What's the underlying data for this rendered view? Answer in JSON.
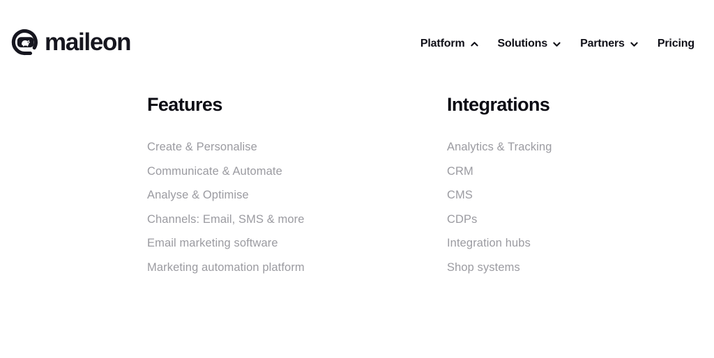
{
  "brand": {
    "name": "maileon",
    "logo_icon": "maileon-circle-mark-icon",
    "color": "#16161f"
  },
  "header": {
    "nav_items": [
      {
        "label": "Platform",
        "icon": "chevron-up-icon",
        "expanded": true
      },
      {
        "label": "Solutions",
        "icon": "chevron-down-icon",
        "expanded": false
      },
      {
        "label": "Partners",
        "icon": "chevron-down-icon",
        "expanded": false
      },
      {
        "label": "Pricing",
        "icon": "",
        "expanded": false
      }
    ]
  },
  "mega_menu": {
    "open_for": "Platform",
    "columns": [
      {
        "title": "Features",
        "links": [
          "Create & Personalise",
          "Communicate & Automate",
          "Analyse & Optimise",
          "Channels: Email, SMS & more",
          "Email marketing software",
          "Marketing automation platform"
        ]
      },
      {
        "title": "Integrations",
        "links": [
          "Analytics & Tracking",
          "CRM",
          "CMS",
          "CDPs",
          "Integration hubs",
          "Shop systems"
        ]
      }
    ]
  },
  "colors": {
    "background": "#ffffff",
    "heading": "#0c0c14",
    "nav_text": "#101018",
    "link_text": "#9b9ba1"
  }
}
